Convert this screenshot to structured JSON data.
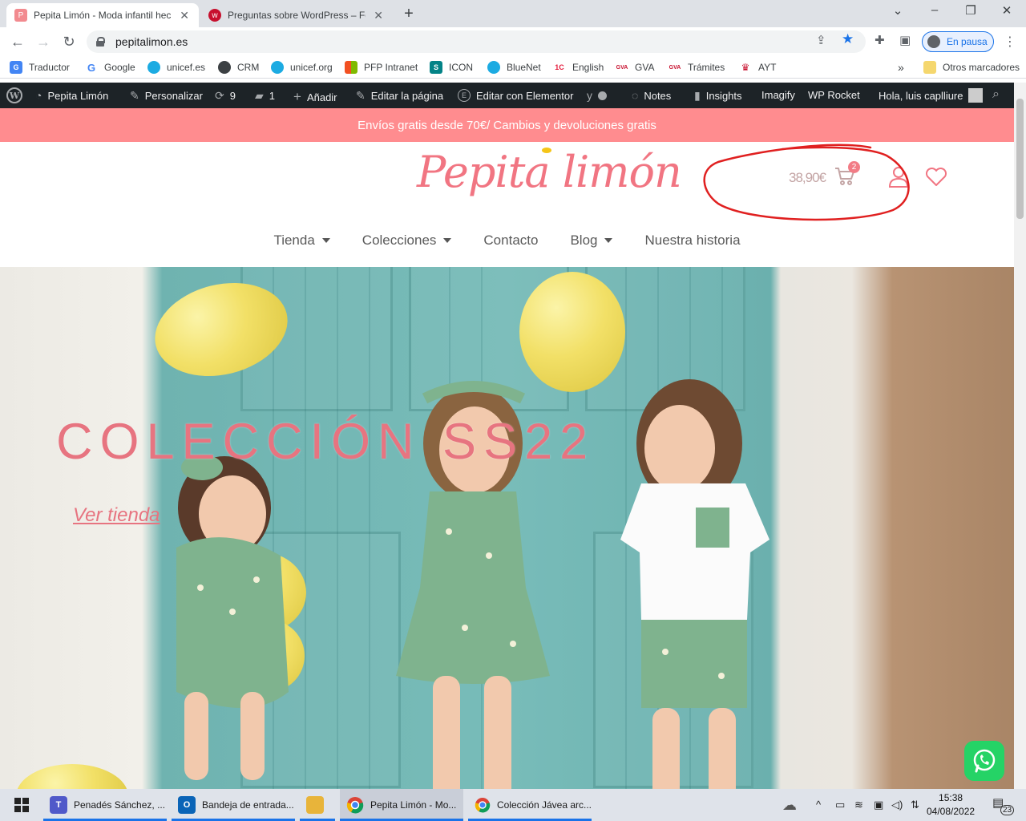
{
  "browser": {
    "tabs": [
      {
        "title": "Pepita Limón - Moda infantil hech",
        "active": true
      },
      {
        "title": "Preguntas sobre WordPress – Foro",
        "active": false
      }
    ],
    "url": "pepitalimon.es",
    "profile_label": "En pausa",
    "bookmarks": [
      "Traductor",
      "Google",
      "unicef.es",
      "CRM",
      "unicef.org",
      "PFP Intranet",
      "ICON",
      "BlueNet",
      "English",
      "GVA",
      "Trámites",
      "AYT"
    ],
    "bookmark_icons": {
      "PFP": "1C",
      "GVA": "GVA",
      "Tramites": "GVA"
    },
    "other_bookmarks": "Otros marcadores",
    "overflow": "»"
  },
  "wp_admin_bar": {
    "site": "Pepita Limón",
    "customize": "Personalizar",
    "updates": "9",
    "comments": "1",
    "add": "Añadir",
    "edit_page": "Editar la página",
    "edit_elementor": "Editar con Elementor",
    "notes": "Notes",
    "insights": "Insights",
    "imagify": "Imagify",
    "wp_rocket": "WP Rocket",
    "greeting": "Hola, luis caplliure"
  },
  "site": {
    "promo": "Envíos gratis desde 70€/ Cambios y devoluciones gratis",
    "logo": "Pepita limón",
    "cart_total": "38,90€",
    "cart_count": "2",
    "nav": [
      {
        "label": "Tienda",
        "dropdown": true
      },
      {
        "label": "Colecciones",
        "dropdown": true
      },
      {
        "label": "Contacto",
        "dropdown": false
      },
      {
        "label": "Blog",
        "dropdown": true
      },
      {
        "label": "Nuestra historia",
        "dropdown": false
      }
    ],
    "hero_title": "COLECCIÓN SS22",
    "hero_link": "Ver tienda"
  },
  "taskbar": {
    "apps": [
      {
        "label": "Penadés Sánchez, ...",
        "color": "#5059c9",
        "icon": "T"
      },
      {
        "label": "Bandeja de entrada...",
        "color": "#0a64b7",
        "icon": "O"
      },
      {
        "label": "",
        "color": "#e8b43a",
        "icon": ""
      },
      {
        "label": "Pepita Limón - Mo...",
        "color": "#ffffff",
        "icon": ""
      },
      {
        "label": "Colección Jávea arc...",
        "color": "#ffffff",
        "icon": ""
      }
    ],
    "time": "15:38",
    "date": "04/08/2022",
    "notifications": "23"
  },
  "colors": {
    "accent": "#f17582",
    "promo_bg": "#ff8c8f",
    "wp_bar": "#1d2327",
    "annotation": "#e02020"
  }
}
